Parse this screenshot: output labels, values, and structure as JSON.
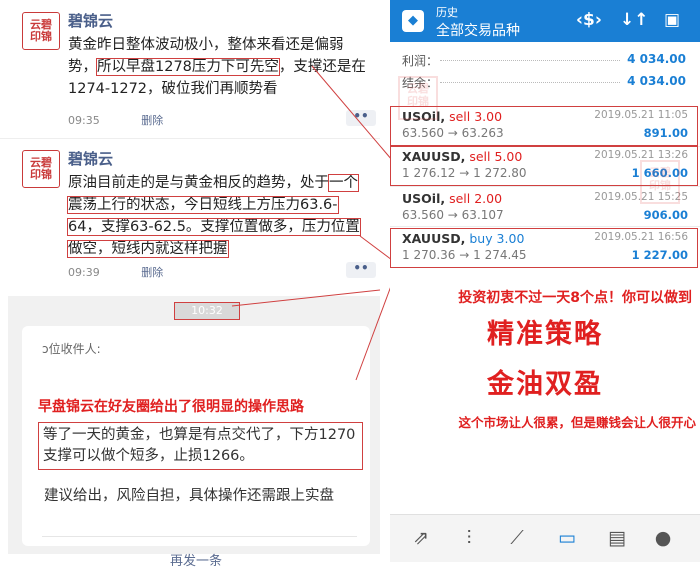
{
  "posts": [
    {
      "avatar": "云碧印锦",
      "name": "碧锦云",
      "text_a": "黄金昨日整体波动极小，整体来看还是偏弱势，",
      "text_hl": "所以早盘1278压力下可先空",
      "text_b": "，支撑还是在1274-1272，破位我们再顺势看",
      "time": "09:35",
      "delete": "删除",
      "more": "••"
    },
    {
      "avatar": "云碧印锦",
      "name": "碧锦云",
      "text_a": "原油目前走的是与黄金相反的趋势，处于",
      "text_hl": "一个震荡上行的状态，今日短线上方压力63.6-64，支撑63-62.5。支撑位置做多，压力位置做空，短线内就这样把握",
      "time": "09:39",
      "delete": "删除",
      "more": "••"
    }
  ],
  "message": {
    "time": "10:32",
    "to": "ↄ位收件人:",
    "banner": "早盘锦云在好友圈给出了很明显的操作思路",
    "body1": "等了一天的黄金，也算是有点交代了，下方1270支撑可以做个短多，止损1266。",
    "body2": "建议给出，风险自担，具体操作还需跟上实盘",
    "resend": "再发一条"
  },
  "app": {
    "header_small": "历史",
    "header_title": "全部交易品种",
    "icons": [
      "sort-currency-icon",
      "sort-arrows-icon",
      "calendar-icon"
    ],
    "summary": [
      {
        "label": "利润：",
        "value": "4 034.00"
      },
      {
        "label": "结余：",
        "value": "4 034.00"
      }
    ],
    "trades": [
      {
        "symbol": "USOil,",
        "side": " sell 3.00",
        "side_color": "#e02020",
        "prices": "63.560 → 63.263",
        "date": "2019.05.21 11:05",
        "profit": "891.00"
      },
      {
        "symbol": "XAUUSD,",
        "side": " sell 5.00",
        "side_color": "#e02020",
        "prices": "1 276.12 → 1 272.80",
        "date": "2019.05.21 13:26",
        "profit": "1 660.00"
      },
      {
        "symbol": "USOil,",
        "side": " sell 2.00",
        "side_color": "#e02020",
        "prices": "63.560 → 63.107",
        "date": "2019.05.21 15:25",
        "profit": "906.00"
      },
      {
        "symbol": "XAUUSD,",
        "side": " buy 3.00",
        "side_color": "#1a7fd4",
        "prices": "1 270.36 → 1 274.45",
        "date": "2019.05.21 16:56",
        "profit": "1 227.00"
      }
    ],
    "nav_icons": [
      "trade-icon",
      "quotes-icon",
      "chart-icon",
      "history-icon",
      "news-icon",
      "chat-icon"
    ]
  },
  "promo": {
    "line1": "投资初衷不过一天8个点！你可以做到",
    "big1": "精准策略",
    "big2": "金油双盈",
    "line3": "这个市场让人很累，但是赚钱会让人很开心"
  }
}
